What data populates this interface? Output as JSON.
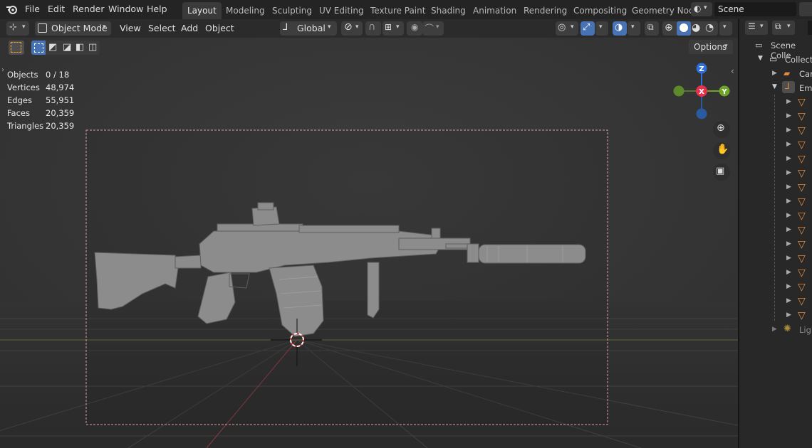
{
  "menu": {
    "file": "File",
    "edit": "Edit",
    "render": "Render",
    "window": "Window",
    "help": "Help"
  },
  "workspaces": [
    "Layout",
    "Modeling",
    "Sculpting",
    "UV Editing",
    "Texture Paint",
    "Shading",
    "Animation",
    "Rendering",
    "Compositing",
    "Geometry Nod"
  ],
  "scene": {
    "name": "Scene"
  },
  "header": {
    "mode": "Object Mode",
    "view": "View",
    "select": "Select",
    "add": "Add",
    "object": "Object",
    "orientation": "Global",
    "options": "Options"
  },
  "stats": {
    "objects_label": "Objects",
    "objects_value": "0 / 18",
    "vertices_label": "Vertices",
    "vertices_value": "48,974",
    "edges_label": "Edges",
    "edges_value": "55,951",
    "faces_label": "Faces",
    "faces_value": "20,359",
    "triangles_label": "Triangles",
    "triangles_value": "20,359"
  },
  "gizmo": {
    "z": "Z",
    "x": "X",
    "y": "Y"
  },
  "outliner": {
    "scene_collection": "Scene Colle",
    "collection": "Collecti",
    "camera": "Car",
    "empty": "Emp",
    "light": "Ligl",
    "mesh_count": 16
  },
  "colors": {
    "accent": "#4772b3",
    "axis_x": "#e5324e",
    "axis_y": "#6ea62a",
    "axis_z": "#2e70d8",
    "mesh_orange": "#e08a3c"
  }
}
